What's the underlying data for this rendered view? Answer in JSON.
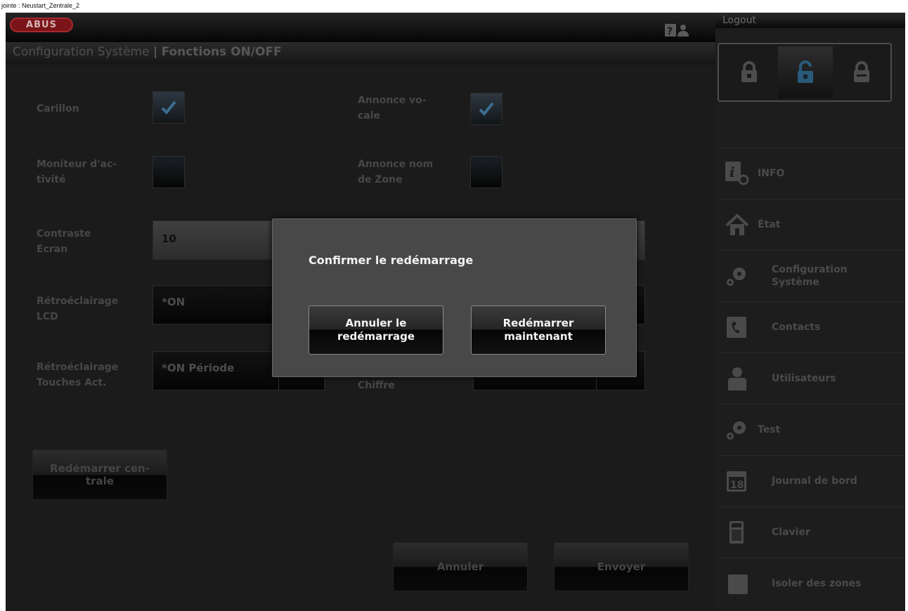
{
  "caption": "jointe : Neustart_Zentrale_2",
  "header": {
    "logo": "ABUS",
    "help_icon": "help-question-icon",
    "logout": "Logout"
  },
  "page": {
    "title_section": "Configuration Système",
    "title_separator": "|",
    "title_page": "Fonctions ON/OFF"
  },
  "form": {
    "carillon": {
      "label": "Carillon",
      "checked": true
    },
    "annonce_vocale": {
      "label": "Annonce vo-\ncale",
      "checked": true
    },
    "moniteur": {
      "label": "Moniteur d'ac-\ntivité",
      "checked": false
    },
    "annonce_zone": {
      "label": "Annonce nom\nde Zone",
      "checked": false
    },
    "contraste": {
      "label": "Contraste\nEcran",
      "value": "10"
    },
    "retro_lcd": {
      "label": "Rétroéclairage\nLCD",
      "value": "*ON"
    },
    "retro_touches": {
      "label": "Rétroéclairage\nTouches Act.",
      "value": "*ON Période"
    },
    "chiffre": {
      "label": "Chiffre",
      "value": ""
    },
    "restart_button": "Redémarrer cen-\ntrale",
    "cancel_button": "Annuler",
    "send_button": "Envoyer"
  },
  "modal": {
    "title": "Confirmer le redémarrage",
    "cancel": "Annuler le\nredémarrage",
    "confirm": "Redémarrer\nmaintenant"
  },
  "sidebar": {
    "locks": [
      {
        "icon": "lock-closed-icon",
        "active": false
      },
      {
        "icon": "lock-open-icon",
        "active": true
      },
      {
        "icon": "lock-closed-icon",
        "active": false
      }
    ],
    "items": [
      {
        "label": "INFO",
        "icon": "info-icon"
      },
      {
        "label": "État",
        "icon": "house-icon"
      },
      {
        "label": "Configuration\nSystème",
        "icon": "gears-icon"
      },
      {
        "label": "Contacts",
        "icon": "contacts-icon"
      },
      {
        "label": "Utilisateurs",
        "icon": "user-icon"
      },
      {
        "label": "Test",
        "icon": "gears-icon"
      },
      {
        "label": "Journal de bord",
        "icon": "calendar-icon"
      },
      {
        "label": "Clavier",
        "icon": "keypad-icon"
      },
      {
        "label": "Isoler des zones",
        "icon": "square-icon"
      }
    ]
  },
  "colors": {
    "accent_blue": "#2a5a7a",
    "brand_red": "#7a1418",
    "modal_bg": "#484848"
  }
}
